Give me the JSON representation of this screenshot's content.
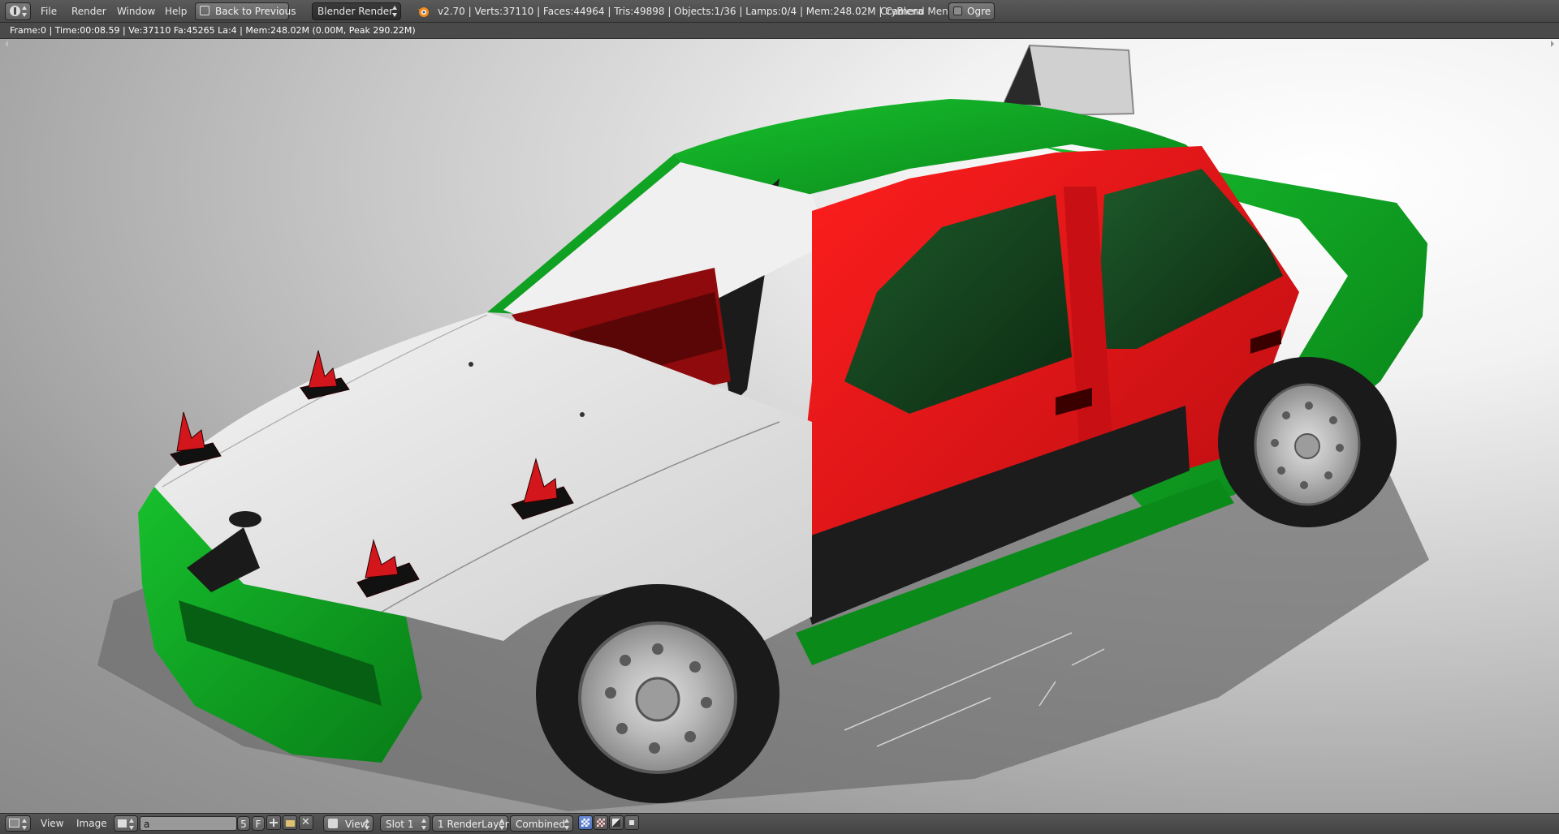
{
  "topbar": {
    "menus": [
      "File",
      "Render",
      "Window",
      "Help"
    ],
    "back_button": "Back to Previous",
    "engine": "Blender Render",
    "stats": "v2.70 | Verts:37110 | Faces:44964 | Tris:49898 | Objects:1/36 | Lamps:0/4 | Mem:248.02M | Camera",
    "crybend_menu": "CryBlend Menu",
    "ogre": "Ogre"
  },
  "render_info": "Frame:0 | Time:00:08.59 | Ve:37110 Fa:45265 La:4 | Mem:248.02M (0.00M, Peak 290.22M)",
  "bottombar": {
    "menus": [
      "View",
      "Image"
    ],
    "image_name": "a",
    "users": "5",
    "fake_user": "F",
    "view_select": "View",
    "slot_select": "Slot 1",
    "layer_select": "1 RenderLayer",
    "pass_select": "Combined"
  },
  "icons": {
    "info_editor": "info-editor-icon",
    "blender_logo": "blender-logo-icon",
    "image_editor": "image-editor-icon",
    "image_browse": "image-browse-icon",
    "new_image": "add-icon",
    "open_image": "folder-icon",
    "unlink": "close-icon",
    "view_mode": "view-mode-icon",
    "draw_alpha": "checker-icon",
    "draw_zbuffer": "zbuffer-icon",
    "draw_channels": "channels-icon",
    "draw_flag": "flag-icon"
  },
  "colors": {
    "car_green": "#0a9a1e",
    "car_red": "#e0141a",
    "car_white": "#e8e8e8",
    "active_blue": "#5a7cc8"
  }
}
